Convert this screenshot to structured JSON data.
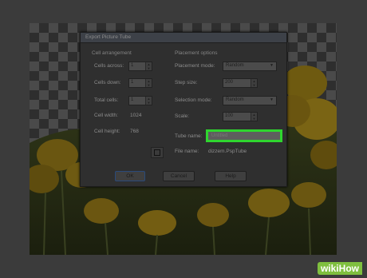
{
  "dialog": {
    "title": "Export Picture Tube",
    "cell_arrangement": {
      "title": "Cell arrangement",
      "cells_across_label": "Cells across:",
      "cells_across_value": "1",
      "cells_down_label": "Cells down:",
      "cells_down_value": "1",
      "total_cells_label": "Total cells:",
      "total_cells_value": "1",
      "cell_width_label": "Cell width:",
      "cell_width_value": "1024",
      "cell_height_label": "Cell height:",
      "cell_height_value": "768"
    },
    "placement_options": {
      "title": "Placement options",
      "placement_mode_label": "Placement mode:",
      "placement_mode_value": "Random",
      "step_size_label": "Step size:",
      "step_size_value": "200",
      "selection_mode_label": "Selection mode:",
      "selection_mode_value": "Random",
      "scale_label": "Scale:",
      "scale_value": "100",
      "tube_name_label": "Tube name:",
      "tube_name_value": "Untitled",
      "file_name_label": "File name:",
      "file_name_value": "dizzem.PspTube"
    },
    "buttons": {
      "ok": "OK",
      "cancel": "Cancel",
      "help": "Help"
    }
  },
  "watermark": {
    "prefix": "wiki",
    "suffix": "How"
  },
  "colors": {
    "highlight": "#2fd52f",
    "flower": "#b08a10",
    "watermark_bg": "#7fbf3f"
  }
}
